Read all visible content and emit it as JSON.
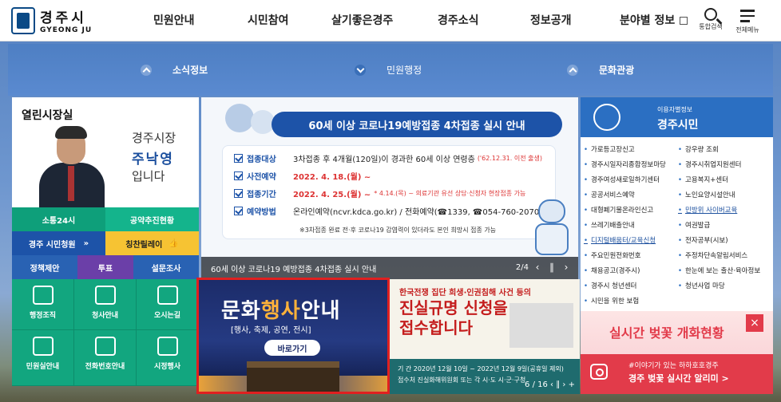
{
  "header": {
    "logo_ko": "경주시",
    "logo_en": "GYEONG JU",
    "nav": [
      "민원안내",
      "시민참여",
      "살기좋은경주",
      "경주소식",
      "정보공개",
      "분야별 정보"
    ],
    "search_label": "통합검색",
    "menu_label": "전체메뉴"
  },
  "subnav": [
    "소식정보",
    "민원행정",
    "문화관광"
  ],
  "mayor": {
    "title": "열린시장실",
    "role": "경주시장",
    "name": "주낙영",
    "suffix": "입니다"
  },
  "quick": {
    "b1": "소통24시",
    "b2": "공약추진현황",
    "b3": "경주 시민청원",
    "b4": "칭찬릴레이",
    "b5": "정책제안",
    "b6": "투표",
    "b7": "설문조사"
  },
  "tiles": [
    "행정조직",
    "청사안내",
    "오시는길",
    "민원실안내",
    "전화번호안내",
    "시정행사"
  ],
  "banner": {
    "headline": "60세 이상 코로나19예방접종 4차접종 실시 안내",
    "row1_label": "접종대상",
    "row1_text": "3차접종 후 4개월(120일)이 경과한 60세 이상 연령층",
    "row1_small": "('62.12.31. 이전 출생)",
    "row2_label": "사전예약",
    "row2_text": "2022. 4. 18.(월) ~",
    "row3_label": "접종기간",
    "row3_text": "2022. 4. 25.(월) ~",
    "row3_small": "* 4.14.(목) ~ 의료기관 유선 상담·신청자 현장접종 가능",
    "row4_label": "예약방법",
    "row4_text": "온라인예약(ncvr.kdca.go.kr) / 전화예약(☎1339, ☎054-760-2070)",
    "note": "※3차접종 완료 전·후 코로나19 감염력이 있더라도 본인 희망시 접종 가능",
    "caption": "60세 이상 코로나19 예방접종 4차접종 실시 안내",
    "pager": "2/4"
  },
  "culture": {
    "title_a": "문화",
    "title_b": "행사",
    "title_c": "안내",
    "sub": "[행사, 축제, 공연, 전시]",
    "button": "바로가기"
  },
  "truth": {
    "sub": "한국전쟁 집단 희생·인권침해 사건 등의",
    "title1": "진실규명 신청을",
    "title2": "접수합니다",
    "info1": "기 간  2020년 12월 10일 ~ 2022년 12월 9일(공휴일 제외)",
    "info2": "접수처  진실화해위원회 또는 각 시·도 시·군·구청",
    "pager": "6 / 16"
  },
  "citizen": {
    "caption": "이용자별정보",
    "title": "경주시민",
    "links": [
      "가로등고장신고",
      "강우량 조회",
      "경주시일자리종합정보마당",
      "경주시취업지원센터",
      "경주여성새로일하기센터",
      "고용복지+센터",
      "공공서비스예약",
      "노인요양시설안내",
      "대형폐기물온라인신고",
      "민방위 사이버교육",
      "쓰레기배출안내",
      "여권발급",
      "디지털배움터/교육신청",
      "전자공부(시보)",
      "주요민원전화번호",
      "주정차단속알림서비스",
      "채용공고(경주시)",
      "한눈에 보는 출산·육아정보",
      "경주시 청년센터",
      "청년사업 마당",
      "시민을 위한 보험"
    ]
  },
  "cherry": {
    "title": "실시간 벚꽃 개화현황",
    "close": "×",
    "line1": "#이야기가 있는 하하호호경주",
    "line2": "경주 벚꽃 실시간 알리미 >"
  },
  "colors": {
    "primary": "#1d53a8",
    "green": "#12a67f",
    "accent_red": "#e02020"
  }
}
